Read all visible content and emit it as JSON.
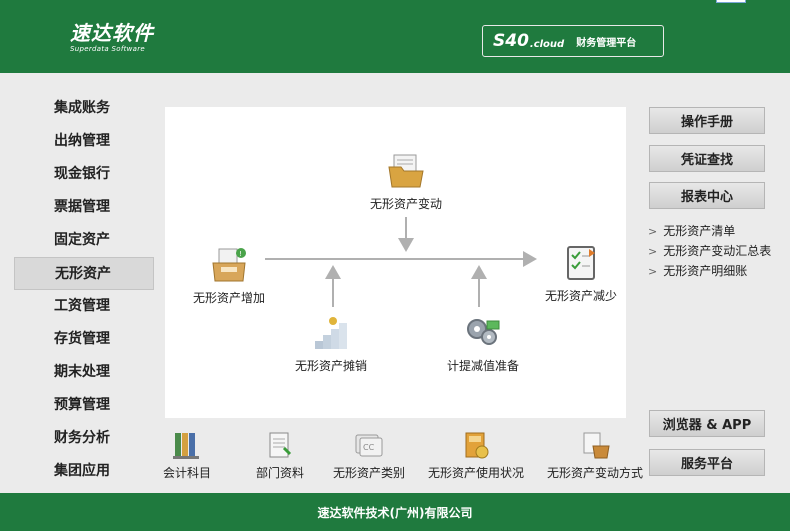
{
  "header": {
    "logo_main": "速达软件",
    "logo_sub": "Superdata Software",
    "brand_s40": "S40",
    "brand_cloud": ".cloud",
    "brand_text": "财务管理平台"
  },
  "sidebar": {
    "items": [
      {
        "label": "集成账务"
      },
      {
        "label": "出纳管理"
      },
      {
        "label": "现金银行"
      },
      {
        "label": "票据管理"
      },
      {
        "label": "固定资产"
      },
      {
        "label": "无形资产",
        "active": true
      },
      {
        "label": "工资管理"
      },
      {
        "label": "存货管理"
      },
      {
        "label": "期末处理"
      },
      {
        "label": "预算管理"
      },
      {
        "label": "财务分析"
      },
      {
        "label": "集团应用"
      }
    ]
  },
  "flow": {
    "change": "无形资产变动",
    "increase": "无形资产增加",
    "decrease": "无形资产减少",
    "amortize": "无形资产摊销",
    "impairment": "计提减值准备"
  },
  "bottom": {
    "items": [
      {
        "label": "会计科目"
      },
      {
        "label": "部门资料"
      },
      {
        "label": "无形资产类别"
      },
      {
        "label": "无形资产使用状况"
      },
      {
        "label": "无形资产变动方式"
      }
    ]
  },
  "right": {
    "manual": "操作手册",
    "voucher": "凭证查找",
    "report_center": "报表中心",
    "reports": [
      {
        "label": "无形资产清单"
      },
      {
        "label": "无形资产变动汇总表"
      },
      {
        "label": "无形资产明细账"
      }
    ],
    "browser_app": "浏览器 & APP",
    "service": "服务平台"
  },
  "footer": {
    "company": "速达软件技术(广州)有限公司"
  },
  "colors": {
    "brand_green": "#1f7a3e",
    "panel_bg": "#ebebeb",
    "arrow_gray": "#b0b0b0"
  }
}
